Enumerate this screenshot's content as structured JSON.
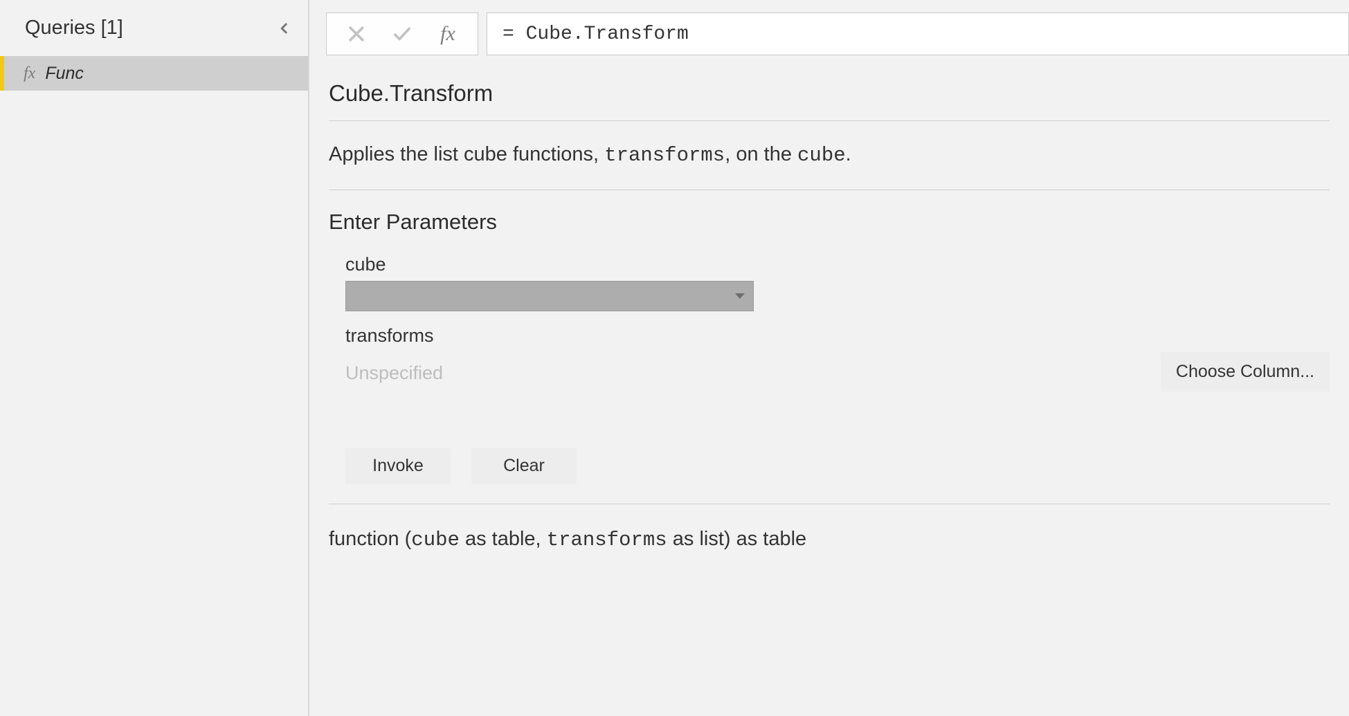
{
  "sidebar": {
    "title": "Queries [1]",
    "items": [
      {
        "icon": "fx",
        "name": "Func"
      }
    ]
  },
  "formulaBar": {
    "value": "= Cube.Transform"
  },
  "function": {
    "name": "Cube.Transform",
    "description": {
      "pre": "Applies the list cube functions, ",
      "code1": "transforms",
      "mid": ", on the ",
      "code2": "cube",
      "post": "."
    },
    "paramsHeader": "Enter Parameters",
    "params": {
      "p1_label": "cube",
      "p2_label": "transforms",
      "p2_value": "Unspecified"
    },
    "buttons": {
      "chooseColumn": "Choose Column...",
      "invoke": "Invoke",
      "clear": "Clear"
    },
    "signature": {
      "s1": "function (",
      "s2": "cube",
      "s3": " as table, ",
      "s4": "transforms",
      "s5": " as list) as table"
    }
  }
}
